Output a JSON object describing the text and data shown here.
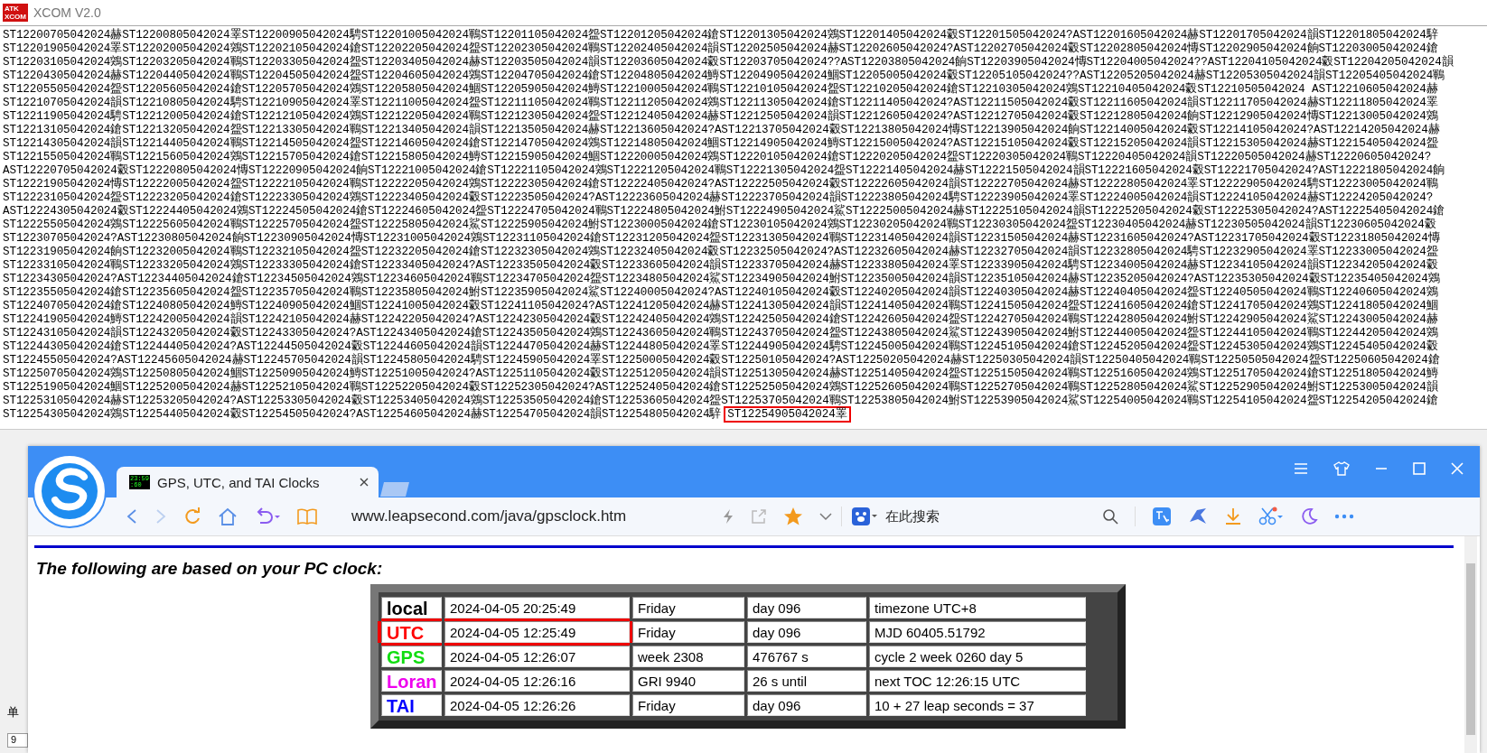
{
  "xcom": {
    "title": "XCOM V2.0",
    "logo": [
      "ATK",
      "XCOM"
    ],
    "receive_lines": [
      "ST12200705042024赫ST12200805042024睪ST12200905042024騁ST12201005042024鶤ST12201105042024盌ST12201205042024鎗ST12201305042024鶟ST12201405042024豰ST12201505042024?AST12201605042024赫ST12201705042024韻ST12201805042024騂",
      "ST12201905042024睪ST12202005042024鶟ST12202105042024鎗ST12202205042024盌ST12202305042024鶤ST12202405042024韻ST12202505042024赫ST12202605042024?AST12202705042024豰ST12202805042024慱ST12202905042024餉ST12203005042024鎗",
      "ST12203105042024鶟ST12203205042024鶤ST12203305042024盌ST12203405042024赫ST12203505042024韻ST12203605042024豰ST12203705042024??AST12203805042024餉ST12203905042024慱ST12204005042024??AST12204105042024豰ST12204205042024韻",
      "ST12204305042024赫ST12204405042024鶤ST12204505042024盌ST12204605042024鶟ST12204705042024鎗ST12204805042024鱄ST12204905042024鯝ST12205005042024豰ST12205105042024??AST12205205042024赫ST12205305042024韻ST12205405042024鶤",
      "ST12205505042024盌ST12205605042024鎗ST12205705042024鶟ST12205805042024鯝ST12205905042024鱄ST12210005042024鶤ST12210105042024盌ST12210205042024鎗ST12210305042024鶟ST12210405042024豰ST12210505042024 AST12210605042024赫",
      "ST12210705042024韻ST12210805042024騁ST12210905042024睪ST12211005042024盌ST12211105042024鶤ST12211205042024鶟ST12211305042024鎗ST12211405042024?AST12211505042024豰ST12211605042024韻ST12211705042024赫ST12211805042024睪",
      "ST12211905042024騁ST12212005042024鎗ST12212105042024鶟ST12212205042024鶤ST12212305042024盌ST12212405042024赫ST12212505042024韻ST12212605042024?AST12212705042024豰ST12212805042024餉ST12212905042024慱ST12213005042024鶟",
      "ST12213105042024鎗ST12213205042024盌ST12213305042024鶤ST12213405042024韻ST12213505042024赫ST12213605042024?AST12213705042024豰ST12213805042024慱ST12213905042024餉ST12214005042024豰ST12214105042024?AST12214205042024赫",
      "ST12214305042024韻ST12214405042024鶤ST12214505042024盌ST12214605042024鎗ST12214705042024鶟ST12214805042024鯝ST12214905042024鱄ST12215005042024?AST12215105042024豰ST12215205042024韻ST12215305042024赫ST12215405042024盌",
      "ST12215505042024鶤ST12215605042024鶟ST12215705042024鎗ST12215805042024鱄ST12215905042024鯝ST12220005042024鶟ST12220105042024鎗ST12220205042024盌ST12220305042024鶤ST12220405042024韻ST12220505042024赫ST12220605042024?",
      "AST12220705042024豰ST12220805042024慱ST12220905042024餉ST12221005042024鎗ST12221105042024鶟ST12221205042024鶤ST12221305042024盌ST12221405042024赫ST12221505042024韻ST12221605042024豰ST12221705042024?AST12221805042024餉",
      "ST12221905042024慱ST12222005042024盌ST12222105042024鶤ST12222205042024鶟ST12222305042024鎗ST12222405042024?AST12222505042024豰ST12222605042024韻ST12222705042024赫ST12222805042024睪ST12222905042024騁ST12223005042024鶤",
      "ST12223105042024盌ST12223205042024鎗ST12223305042024鶟ST12223405042024豰ST12223505042024?AST12223605042024赫ST12223705042024韻ST12223805042024騁ST12223905042024睪ST12224005042024韻ST12224105042024赫ST12224205042024?",
      "AST12224305042024豰ST12224405042024鶟ST12224505042024鎗ST12224605042024盌ST12224705042024鶤ST12224805042024鮒ST12224905042024鯊ST12225005042024赫ST12225105042024韻ST12225205042024豰ST12225305042024?AST12225405042024鎗",
      "ST12225505042024鶟ST12225605042024鶤ST12225705042024盌ST12225805042024鯊ST12225905042024鮒ST12230005042024鎗ST12230105042024鶟ST12230205042024鶤ST12230305042024盌ST12230405042024赫ST12230505042024韻ST12230605042024豰",
      "ST12230705042024?AST12230805042024餉ST12230905042024慱ST12231005042024鶟ST12231105042024鎗ST12231205042024盌ST12231305042024鶤ST12231405042024韻ST12231505042024赫ST12231605042024?AST12231705042024豰ST12231805042024慱",
      "ST12231905042024餉ST12232005042024鶤ST12232105042024盌ST12232205042024鎗ST12232305042024鶟ST12232405042024豰ST12232505042024?AST12232605042024赫ST12232705042024韻ST12232805042024騁ST12232905042024睪ST12233005042024盌",
      "ST12233105042024鶤ST12233205042024鶟ST12233305042024鎗ST12233405042024?AST12233505042024豰ST12233605042024韻ST12233705042024赫ST12233805042024睪ST12233905042024騁ST12234005042024赫ST12234105042024韻ST12234205042024豰",
      "ST12234305042024?AST12234405042024鎗ST12234505042024鶟ST12234605042024鶤ST12234705042024盌ST12234805042024鯊ST12234905042024鮒ST12235005042024韻ST12235105042024赫ST12235205042024?AST12235305042024豰ST12235405042024鶟",
      "ST12235505042024鎗ST12235605042024盌ST12235705042024鶤ST12235805042024鮒ST12235905042024鯊ST12240005042024?AST12240105042024豰ST12240205042024韻ST12240305042024赫ST12240405042024盌ST12240505042024鶤ST12240605042024鶟",
      "ST12240705042024鎗ST12240805042024鱄ST12240905042024鯝ST12241005042024豰ST12241105042024?AST12241205042024赫ST12241305042024韻ST12241405042024鶤ST12241505042024盌ST12241605042024鎗ST12241705042024鶟ST12241805042024鯝",
      "ST12241905042024鱄ST12242005042024韻ST12242105042024赫ST12242205042024?AST12242305042024豰ST12242405042024鶟ST12242505042024鎗ST12242605042024盌ST12242705042024鶤ST12242805042024鮒ST12242905042024鯊ST12243005042024赫",
      "ST12243105042024韻ST12243205042024豰ST12243305042024?AST12243405042024鎗ST12243505042024鶟ST12243605042024鶤ST12243705042024盌ST12243805042024鯊ST12243905042024鮒ST12244005042024盌ST12244105042024鶤ST12244205042024鶟",
      "ST12244305042024鎗ST12244405042024?AST12244505042024豰ST12244605042024韻ST12244705042024赫ST12244805042024睪ST12244905042024騁ST12245005042024鶤ST12245105042024鎗ST12245205042024盌ST12245305042024鶟ST12245405042024豰",
      "ST12245505042024?AST12245605042024赫ST12245705042024韻ST12245805042024騁ST12245905042024睪ST12250005042024豰ST12250105042024?AST12250205042024赫ST12250305042024韻ST12250405042024鶤ST12250505042024盌ST12250605042024鎗",
      "ST12250705042024鶟ST12250805042024鯝ST12250905042024鱄ST12251005042024?AST12251105042024豰ST12251205042024韻ST12251305042024赫ST12251405042024盌ST12251505042024鶤ST12251605042024鶟ST12251705042024鎗ST12251805042024鱄",
      "ST12251905042024鯝ST12252005042024赫ST12252105042024鶤ST12252205042024豰ST12252305042024?AST12252405042024鎗ST12252505042024鶟ST12252605042024鶤ST12252705042024鶤ST12252805042024鯊ST12252905042024鮒ST12253005042024韻",
      "ST12253105042024赫ST12253205042024?AST12253305042024豰ST12253405042024鶟ST12253505042024鎗ST12253605042024盌ST12253705042024鶤ST12253805042024鮒ST12253905042024鯊ST12254005042024鶤ST12254105042024盌ST12254205042024鎗",
      "ST12254305042024鶟ST12254405042024豰ST12254505042024?AST12254605042024赫ST12254705042024韻ST12254805042024騂"
    ],
    "highlighted_record": "ST12254905042024睪",
    "bottom_label": "单",
    "bottom_field": "9"
  },
  "browser": {
    "tabs": [
      {
        "title": "GPS, UTC, and TAI Clocks",
        "favicon": [
          "23:59",
          ":60"
        ],
        "selected": true
      }
    ],
    "url": "www.leapsecond.com/java/gpsclock.htm",
    "search_placeholder": "在此搜索",
    "page": {
      "heading": "The following are based on your PC clock:",
      "rows": [
        {
          "label": "local",
          "color": "#000000",
          "annotated": false,
          "cells": [
            "2024-04-05 20:25:49",
            "Friday",
            "day 096",
            "timezone UTC+8"
          ]
        },
        {
          "label": "UTC",
          "color": "#ff0000",
          "annotated": true,
          "cells": [
            "2024-04-05 12:25:49",
            "Friday",
            "day 096",
            "MJD 60405.51792"
          ]
        },
        {
          "label": "GPS",
          "color": "#11dd11",
          "annotated": false,
          "cells": [
            "2024-04-05 12:26:07",
            "week 2308",
            "476767 s",
            "cycle 2 week 0260 day 5"
          ]
        },
        {
          "label": "Loran",
          "color": "#ee00ee",
          "annotated": false,
          "cells": [
            "2024-04-05 12:26:16",
            "GRI 9940",
            "26 s until",
            "next TOC 12:26:15 UTC"
          ]
        },
        {
          "label": "TAI",
          "color": "#0000ff",
          "annotated": false,
          "cells": [
            "2024-04-05 12:26:26",
            "Friday",
            "day 096",
            "10 + 27 leap seconds = 37"
          ]
        }
      ]
    }
  }
}
